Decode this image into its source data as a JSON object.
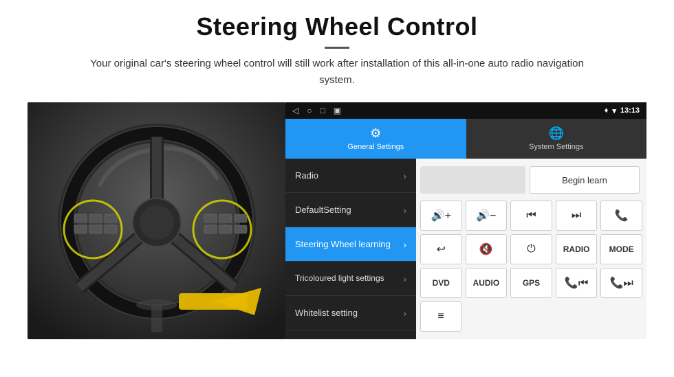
{
  "header": {
    "title": "Steering Wheel Control",
    "divider": true,
    "subtitle": "Your original car's steering wheel control will still work after installation of this all-in-one auto radio navigation system."
  },
  "status_bar": {
    "nav_icons": [
      "◁",
      "○",
      "□",
      "▣"
    ],
    "right_icons": [
      "♦",
      "▾"
    ],
    "time": "13:13"
  },
  "tabs": [
    {
      "label": "General Settings",
      "icon": "⚙",
      "active": true
    },
    {
      "label": "System Settings",
      "icon": "🌐",
      "active": false
    }
  ],
  "menu_items": [
    {
      "label": "Radio",
      "active": false
    },
    {
      "label": "DefaultSetting",
      "active": false
    },
    {
      "label": "Steering Wheel learning",
      "active": true
    },
    {
      "label": "Tricoloured light settings",
      "active": false
    },
    {
      "label": "Whitelist setting",
      "active": false
    }
  ],
  "controls": {
    "begin_learn_label": "Begin learn",
    "rows": [
      [
        "🔊+",
        "🔊−",
        "⏮",
        "⏭",
        "📞"
      ],
      [
        "↩",
        "🔊✕",
        "⏻",
        "RADIO",
        "MODE"
      ],
      [
        "DVD",
        "AUDIO",
        "GPS",
        "📞⏮",
        "📞⏭"
      ]
    ],
    "last_row": [
      "≡"
    ]
  }
}
